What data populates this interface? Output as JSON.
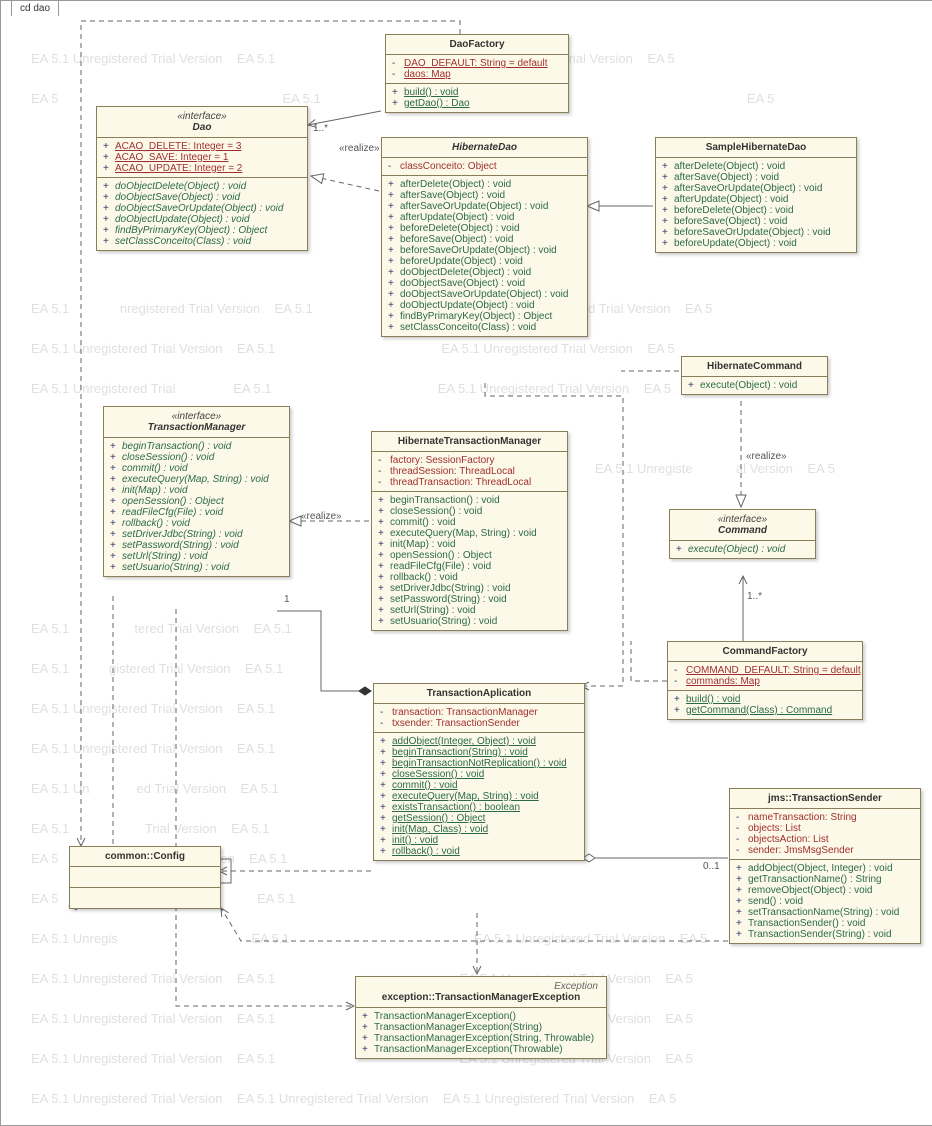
{
  "diagram": {
    "tab": "cd dao",
    "exception_stereo": "Exception",
    "realize_label": "«realize»"
  },
  "mult": {
    "one": "1",
    "oneMany": "1..*",
    "zeroOne": "0..1"
  },
  "daoFactory": {
    "name": "DaoFactory",
    "a1": "DAO_DEFAULT:  String = default",
    "a2": "daos:  Map",
    "o1": "build() : void",
    "o2": "getDao() : Dao"
  },
  "dao": {
    "stereo": "«interface»",
    "name": "Dao",
    "a1": "ACAO_DELETE:  Integer = 3",
    "a2": "ACAO_SAVE:  Integer = 1",
    "a3": "ACAO_UPDATE:  Integer = 2",
    "o1": "doObjectDelete(Object) : void",
    "o2": "doObjectSave(Object) : void",
    "o3": "doObjectSaveOrUpdate(Object) : void",
    "o4": "doObjectUpdate(Object) : void",
    "o5": "findByPrimaryKey(Object) : Object",
    "o6": "setClassConceito(Class) : void"
  },
  "hibernateDao": {
    "name": "HibernateDao",
    "a1": "classConceito:  Object",
    "o1": "afterDelete(Object) : void",
    "o2": "afterSave(Object) : void",
    "o3": "afterSaveOrUpdate(Object) : void",
    "o4": "afterUpdate(Object) : void",
    "o5": "beforeDelete(Object) : void",
    "o6": "beforeSave(Object) : void",
    "o7": "beforeSaveOrUpdate(Object) : void",
    "o8": "beforeUpdate(Object) : void",
    "o9": "doObjectDelete(Object) : void",
    "o10": "doObjectSave(Object) : void",
    "o11": "doObjectSaveOrUpdate(Object) : void",
    "o12": "doObjectUpdate(Object) : void",
    "o13": "findByPrimaryKey(Object) : Object",
    "o14": "setClassConceito(Class) : void"
  },
  "sampleDao": {
    "name": "SampleHibernateDao",
    "o1": "afterDelete(Object) : void",
    "o2": "afterSave(Object) : void",
    "o3": "afterSaveOrUpdate(Object) : void",
    "o4": "afterUpdate(Object) : void",
    "o5": "beforeDelete(Object) : void",
    "o6": "beforeSave(Object) : void",
    "o7": "beforeSaveOrUpdate(Object) : void",
    "o8": "beforeUpdate(Object) : void"
  },
  "hibernateCommand": {
    "name": "HibernateCommand",
    "o1": "execute(Object) : void"
  },
  "command": {
    "stereo": "«interface»",
    "name": "Command",
    "o1": "execute(Object) : void"
  },
  "commandFactory": {
    "name": "CommandFactory",
    "a1": "COMMAND_DEFAULT:  String = default",
    "a2": "commands:  Map",
    "o1": "build() : void",
    "o2": "getCommand(Class) : Command"
  },
  "tm": {
    "stereo": "«interface»",
    "name": "TransactionManager",
    "o1": "beginTransaction() : void",
    "o2": "closeSession() : void",
    "o3": "commit() : void",
    "o4": "executeQuery(Map, String) : void",
    "o5": "init(Map) : void",
    "o6": "openSession() : Object",
    "o7": "readFileCfg(File) : void",
    "o8": "rollback() : void",
    "o9": "setDriverJdbc(String) : void",
    "o10": "setPassword(String) : void",
    "o11": "setUrl(String) : void",
    "o12": "setUsuario(String) : void"
  },
  "htm": {
    "name": "HibernateTransactionManager",
    "a1": "factory:  SessionFactory",
    "a2": "threadSession:  ThreadLocal",
    "a3": "threadTransaction:  ThreadLocal",
    "o1": "beginTransaction() : void",
    "o2": "closeSession() : void",
    "o3": "commit() : void",
    "o4": "executeQuery(Map, String) : void",
    "o5": "init(Map) : void",
    "o6": "openSession() : Object",
    "o7": "readFileCfg(File) : void",
    "o8": "rollback() : void",
    "o9": "setDriverJdbc(String) : void",
    "o10": "setPassword(String) : void",
    "o11": "setUrl(String) : void",
    "o12": "setUsuario(String) : void"
  },
  "ta": {
    "name": "TransactionAplication",
    "a1": "transaction:  TransactionManager",
    "a2": "txsender:  TransactionSender",
    "o1": "addObject(Integer, Object) : void",
    "o2": "beginTransaction(String) : void",
    "o3": "beginTransactionNotReplication() : void",
    "o4": "closeSession() : void",
    "o5": "commit() : void",
    "o6": "executeQuery(Map, String) : void",
    "o7": "existsTransaction() : boolean",
    "o8": "getSession() : Object",
    "o9": "init(Map, Class) : void",
    "o10": "init() : void",
    "o11": "rollback() : void"
  },
  "config": {
    "name": "common::Config"
  },
  "ts": {
    "name": "jms::TransactionSender",
    "a1": "nameTransaction:  String",
    "a2": "objects:  List",
    "a3": "objectsAction:  List",
    "a4": "sender:  JmsMsgSender",
    "o1": "addObject(Object, Integer) : void",
    "o2": "getTransactionName() : String",
    "o3": "removeObject(Object) : void",
    "o4": "send() : void",
    "o5": "setTransactionName(String) : void",
    "o6": "TransactionSender() : void",
    "o7": "TransactionSender(String) : void"
  },
  "tme": {
    "name": "exception::TransactionManagerException",
    "o1": "TransactionManagerException()",
    "o2": "TransactionManagerException(String)",
    "o3": "TransactionManagerException(String, Throwable)",
    "o4": "TransactionManagerException(Throwable)"
  }
}
